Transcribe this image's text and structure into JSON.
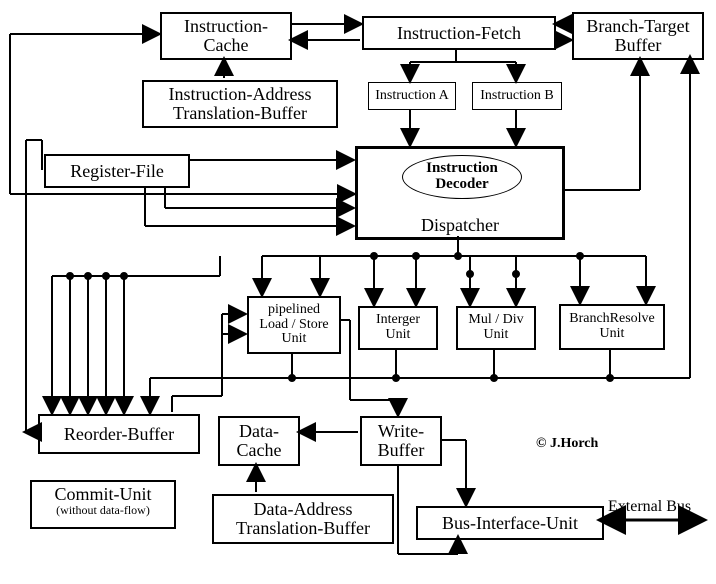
{
  "boxes": {
    "instruction_cache": "Instruction-\nCache",
    "instruction_fetch": "Instruction-Fetch",
    "branch_target_buffer": "Branch-Target\nBuffer",
    "instr_addr_trans_buf": "Instruction-Address\nTranslation-Buffer",
    "instruction_a": "Instruction A",
    "instruction_b": "Instruction B",
    "register_file": "Register-File",
    "instruction_decoder": "Instruction\nDecoder",
    "dispatcher": "Dispatcher",
    "pipelined_lsu": "pipelined\nLoad / Store\nUnit",
    "integer_unit": "Interger\nUnit",
    "mul_div_unit": "Mul / Div\nUnit",
    "branch_resolve_unit": "BranchResolve\nUnit",
    "reorder_buffer": "Reorder-Buffer",
    "data_cache": "Data-\nCache",
    "write_buffer": "Write-\nBuffer",
    "commit_unit": "Commit-Unit",
    "commit_unit_sub": "(without data-flow)",
    "data_addr_trans_buf": "Data-Address\nTranslation-Buffer",
    "bus_interface_unit": "Bus-Interface-Unit"
  },
  "labels": {
    "credit": "© J.Horch",
    "external_bus": "External Bus"
  }
}
